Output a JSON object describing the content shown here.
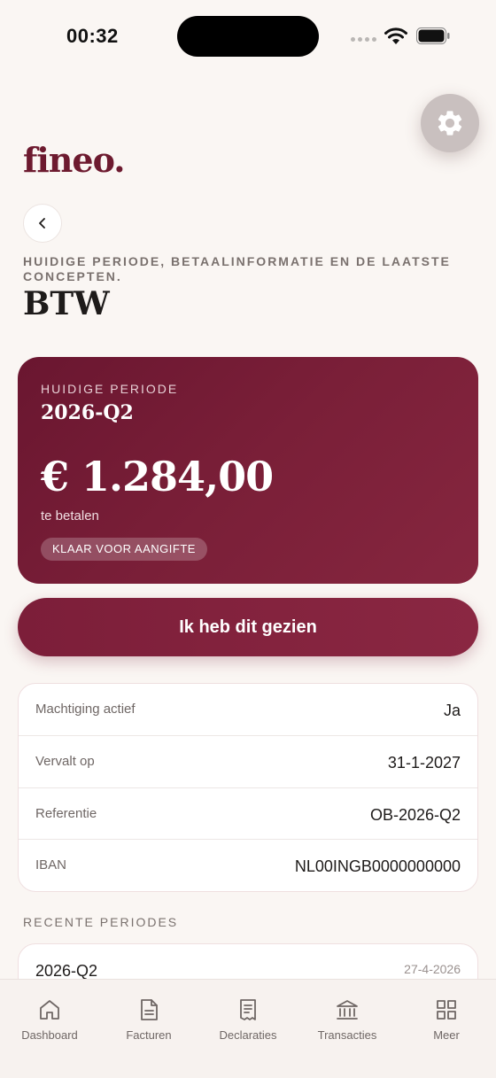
{
  "status_bar": {
    "time": "00:32"
  },
  "header": {
    "logo": "fineo.",
    "subtitle": "HUIDIGE PERIODE, BETAALINFORMATIE EN DE LAATSTE CONCEPTEN.",
    "title": "BTW"
  },
  "hero": {
    "period_label": "HUIDIGE PERIODE",
    "period_value": "2026-Q2",
    "amount": "€ 1.284,00",
    "amount_caption": "te betalen",
    "badge": "KLAAR VOOR AANGIFTE"
  },
  "primary_action": {
    "label": "Ik heb dit gezien"
  },
  "details": [
    {
      "label": "Machtiging actief",
      "value": "Ja"
    },
    {
      "label": "Vervalt op",
      "value": "31-1-2027"
    },
    {
      "label": "Referentie",
      "value": "OB-2026-Q2"
    },
    {
      "label": "IBAN",
      "value": "NL00INGB0000000000"
    }
  ],
  "recent": {
    "section_label": "RECENTE PERIODES",
    "items": [
      {
        "period": "2026-Q2",
        "date": "27-4-2026"
      }
    ]
  },
  "nav": {
    "items": [
      {
        "label": "Dashboard",
        "icon": "home-icon"
      },
      {
        "label": "Facturen",
        "icon": "document-icon"
      },
      {
        "label": "Declaraties",
        "icon": "receipt-icon"
      },
      {
        "label": "Transacties",
        "icon": "bank-icon"
      },
      {
        "label": "Meer",
        "icon": "grid-icon"
      }
    ]
  },
  "colors": {
    "accent": "#7a1f38",
    "background": "#faf6f3"
  }
}
